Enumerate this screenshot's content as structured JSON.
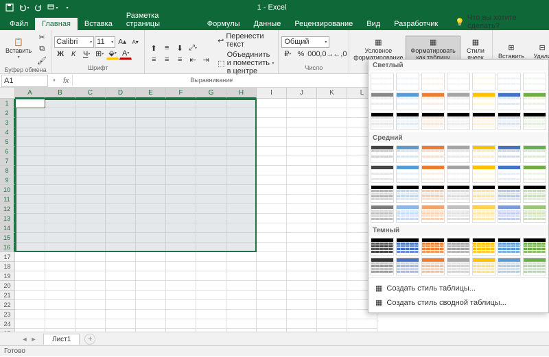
{
  "title": "1 - Excel",
  "tabs": [
    "Файл",
    "Главная",
    "Вставка",
    "Разметка страницы",
    "Формулы",
    "Данные",
    "Рецензирование",
    "Вид",
    "Разработчик"
  ],
  "active_tab": 1,
  "tell_me": "Что вы хотите сделать?",
  "ribbon": {
    "clipboard": {
      "paste": "Вставить",
      "label": "Буфер обмена"
    },
    "font": {
      "name": "Calibri",
      "size": "11",
      "label": "Шрифт"
    },
    "align": {
      "wrap": "Перенести текст",
      "merge": "Объединить и поместить в центре",
      "label": "Выравнивание"
    },
    "number": {
      "format": "Общий",
      "label": "Число"
    },
    "styles": {
      "cond": "Условное форматирование",
      "table": "Форматировать как таблицу",
      "cell": "Стили ячеек"
    },
    "cells": {
      "insert": "Вставить",
      "delete": "Удали"
    }
  },
  "name_box": "A1",
  "columns": [
    "A",
    "B",
    "C",
    "D",
    "E",
    "F",
    "G",
    "H",
    "I",
    "J",
    "K",
    "L"
  ],
  "rows_visible": 25,
  "selection": {
    "cols": 8,
    "rows": 16
  },
  "sheet": "Лист1",
  "status": "Готово",
  "gallery": {
    "sections": [
      "Светлый",
      "Средний",
      "Темный"
    ],
    "new_style": "Создать стиль таблицы...",
    "new_pivot": "Создать стиль сводной таблицы..."
  },
  "palette": {
    "light_accents": [
      "#888888",
      "#5b9bd5",
      "#ed7d31",
      "#a5a5a5",
      "#ffc000",
      "#4472c4",
      "#70ad47"
    ],
    "medium_accents": [
      "#444444",
      "#5b9bd5",
      "#ed7d31",
      "#a5a5a5",
      "#ffc000",
      "#4472c4",
      "#70ad47"
    ],
    "dark_accents": [
      "#333333",
      "#4472c4",
      "#ed7d31",
      "#a5a5a5",
      "#ffc000",
      "#5b9bd5",
      "#70ad47"
    ]
  }
}
